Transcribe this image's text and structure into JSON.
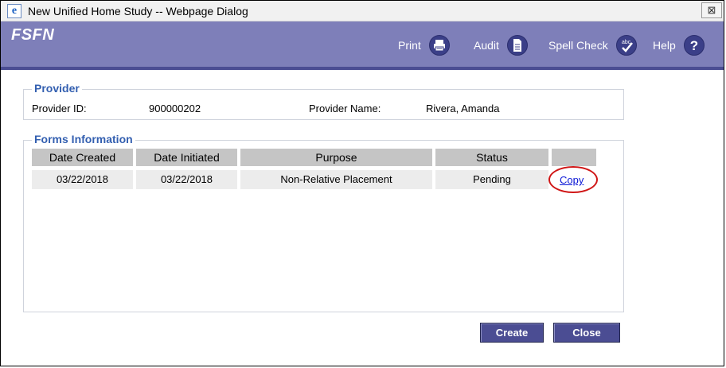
{
  "window": {
    "title": "New Unified Home Study -- Webpage Dialog",
    "close_glyph": "⊠"
  },
  "header": {
    "brand": "FSFN",
    "buttons": [
      {
        "label": "Print",
        "icon": "printer-icon"
      },
      {
        "label": "Audit",
        "icon": "document-icon"
      },
      {
        "label": "Spell Check",
        "icon": "spell-check-icon"
      },
      {
        "label": "Help",
        "icon": "help-icon"
      }
    ]
  },
  "provider": {
    "legend": "Provider",
    "id_label": "Provider ID:",
    "id_value": "900000202",
    "name_label": "Provider Name:",
    "name_value": "Rivera, Amanda"
  },
  "forms": {
    "legend": "Forms Information",
    "columns": [
      "Date Created",
      "Date Initiated",
      "Purpose",
      "Status",
      ""
    ],
    "rows": [
      {
        "date_created": "03/22/2018",
        "date_initiated": "03/22/2018",
        "purpose": "Non-Relative Placement",
        "status": "Pending",
        "action": "Copy"
      }
    ]
  },
  "actions": {
    "create_label": "Create",
    "close_label": "Close"
  },
  "colors": {
    "header_bg": "#7e7fb9",
    "header_border": "#4b4d93",
    "legend_text": "#335fb0",
    "button_bg": "#4b4d93",
    "link": "#0b17d6",
    "highlight": "#d01616"
  }
}
